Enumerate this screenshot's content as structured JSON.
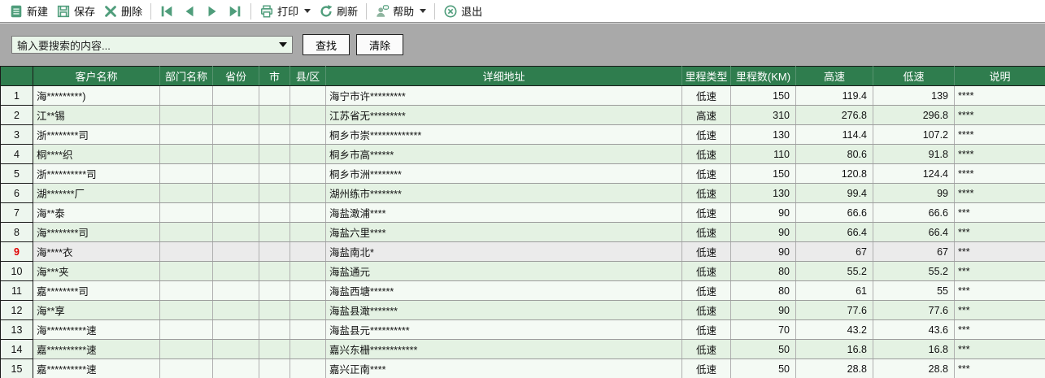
{
  "toolbar": {
    "new_label": "新建",
    "save_label": "保存",
    "delete_label": "删除",
    "print_label": "打印",
    "refresh_label": "刷新",
    "help_label": "帮助",
    "exit_label": "退出"
  },
  "search": {
    "placeholder": "输入要搜索的内容...",
    "find_label": "查找",
    "clear_label": "清除"
  },
  "table": {
    "columns": [
      "客户名称",
      "部门名称",
      "省份",
      "市",
      "县/区",
      "详细地址",
      "里程类型",
      "里程数(KM)",
      "高速",
      "低速",
      "说明"
    ],
    "selected_row_number": 9,
    "rows": [
      {
        "num": "1",
        "customer": "海*********)",
        "department": "",
        "province": "",
        "city": "",
        "county": "",
        "address": "海宁市许*********",
        "mileage_type": "低速",
        "mileage_km": "150",
        "highway": "119.4",
        "lowspeed": "139",
        "note": "****"
      },
      {
        "num": "2",
        "customer": "江**锡",
        "department": "",
        "province": "",
        "city": "",
        "county": "",
        "address": "江苏省无*********",
        "mileage_type": "高速",
        "mileage_km": "310",
        "highway": "276.8",
        "lowspeed": "296.8",
        "note": "****"
      },
      {
        "num": "3",
        "customer": "浙********司",
        "department": "",
        "province": "",
        "city": "",
        "county": "",
        "address": "桐乡市崇*************",
        "mileage_type": "低速",
        "mileage_km": "130",
        "highway": "114.4",
        "lowspeed": "107.2",
        "note": "****"
      },
      {
        "num": "4",
        "customer": "桐****织",
        "department": "",
        "province": "",
        "city": "",
        "county": "",
        "address": "桐乡市高******",
        "mileage_type": "低速",
        "mileage_km": "110",
        "highway": "80.6",
        "lowspeed": "91.8",
        "note": "****"
      },
      {
        "num": "5",
        "customer": "浙**********司",
        "department": "",
        "province": "",
        "city": "",
        "county": "",
        "address": "桐乡市洲********",
        "mileage_type": "低速",
        "mileage_km": "150",
        "highway": "120.8",
        "lowspeed": "124.4",
        "note": "****"
      },
      {
        "num": "6",
        "customer": "湖*******厂",
        "department": "",
        "province": "",
        "city": "",
        "county": "",
        "address": "湖州练市********",
        "mileage_type": "低速",
        "mileage_km": "130",
        "highway": "99.4",
        "lowspeed": "99",
        "note": "****"
      },
      {
        "num": "7",
        "customer": "海**泰",
        "department": "",
        "province": "",
        "city": "",
        "county": "",
        "address": "海盐澉浦****",
        "mileage_type": "低速",
        "mileage_km": "90",
        "highway": "66.6",
        "lowspeed": "66.6",
        "note": "***"
      },
      {
        "num": "8",
        "customer": "海********司",
        "department": "",
        "province": "",
        "city": "",
        "county": "",
        "address": "海盐六里****",
        "mileage_type": "低速",
        "mileage_km": "90",
        "highway": "66.4",
        "lowspeed": "66.4",
        "note": "***"
      },
      {
        "num": "9",
        "customer": "海****衣",
        "department": "",
        "province": "",
        "city": "",
        "county": "",
        "address": "海盐南北*",
        "mileage_type": "低速",
        "mileage_km": "90",
        "highway": "67",
        "lowspeed": "67",
        "note": "***"
      },
      {
        "num": "10",
        "customer": "海***夹",
        "department": "",
        "province": "",
        "city": "",
        "county": "",
        "address": "海盐通元",
        "mileage_type": "低速",
        "mileage_km": "80",
        "highway": "55.2",
        "lowspeed": "55.2",
        "note": "***"
      },
      {
        "num": "11",
        "customer": "嘉********司",
        "department": "",
        "province": "",
        "city": "",
        "county": "",
        "address": "海盐西塘******",
        "mileage_type": "低速",
        "mileage_km": "80",
        "highway": "61",
        "lowspeed": "55",
        "note": "***"
      },
      {
        "num": "12",
        "customer": "海**享",
        "department": "",
        "province": "",
        "city": "",
        "county": "",
        "address": "海盐县澉*******",
        "mileage_type": "低速",
        "mileage_km": "90",
        "highway": "77.6",
        "lowspeed": "77.6",
        "note": "***"
      },
      {
        "num": "13",
        "customer": "海**********速",
        "department": "",
        "province": "",
        "city": "",
        "county": "",
        "address": "海盐县元**********",
        "mileage_type": "低速",
        "mileage_km": "70",
        "highway": "43.2",
        "lowspeed": "43.6",
        "note": "***"
      },
      {
        "num": "14",
        "customer": "嘉**********速",
        "department": "",
        "province": "",
        "city": "",
        "county": "",
        "address": "嘉兴东栅************",
        "mileage_type": "低速",
        "mileage_km": "50",
        "highway": "16.8",
        "lowspeed": "16.8",
        "note": "***"
      },
      {
        "num": "15",
        "customer": "嘉**********速",
        "department": "",
        "province": "",
        "city": "",
        "county": "",
        "address": "嘉兴正南****",
        "mileage_type": "低速",
        "mileage_km": "50",
        "highway": "28.8",
        "lowspeed": "28.8",
        "note": "***"
      }
    ]
  },
  "colors": {
    "header_green": "#2f7d4e",
    "icon_green": "#4f9d7b",
    "row_light": "#f4faf4",
    "row_alt": "#e4f2e3",
    "row_selected": "#ebebeb",
    "panel_gray": "#a9a9a9",
    "combo_bg": "#eaf6ea",
    "selected_number_red": "#e00000"
  }
}
